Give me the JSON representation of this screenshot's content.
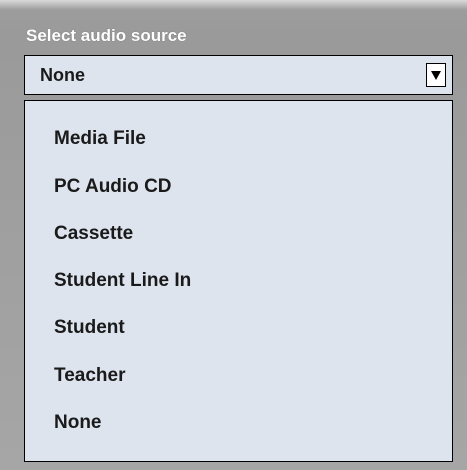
{
  "panel": {
    "title": "Select audio source"
  },
  "select": {
    "selected_value": "None"
  },
  "dropdown": {
    "options": [
      "Media File",
      "PC Audio CD",
      "Cassette",
      "Student Line In",
      "Student",
      "Teacher",
      "None"
    ]
  },
  "icons": {
    "dropdown_arrow": "triangle-down-icon"
  }
}
